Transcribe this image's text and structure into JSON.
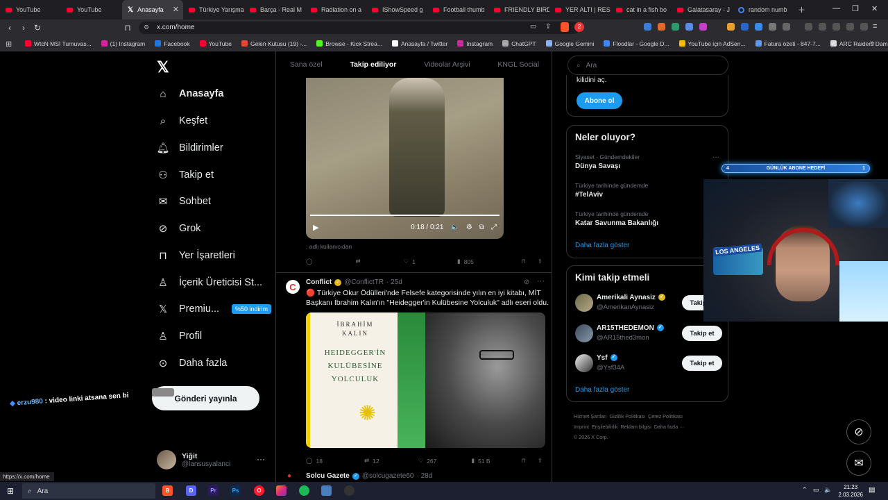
{
  "browser": {
    "tabs": [
      {
        "title": "YouTube",
        "icon": "youtube"
      },
      {
        "title": "YouTube",
        "icon": "youtube"
      },
      {
        "title": "Anasayfa",
        "icon": "x",
        "active": true
      },
      {
        "title": "Türkiye Yarışma",
        "icon": "youtube"
      },
      {
        "title": "Barça - Real M",
        "icon": "youtube"
      },
      {
        "title": "Radiation on a",
        "icon": "youtube"
      },
      {
        "title": "IShowSpeed g",
        "icon": "youtube"
      },
      {
        "title": "Football thumb",
        "icon": "youtube"
      },
      {
        "title": "FRIENDLY BIRD",
        "icon": "youtube"
      },
      {
        "title": "YER ALTI | RESI",
        "icon": "youtube"
      },
      {
        "title": "cat in a fish bo",
        "icon": "youtube"
      },
      {
        "title": "Galatasaray - J",
        "icon": "youtube"
      },
      {
        "title": "random numb",
        "icon": "google"
      }
    ],
    "url": "x.com/home",
    "status_url": "https://x.com/home",
    "notification_count": "2",
    "bookmarks": [
      {
        "label": "WtcN MSI Turnuvas...",
        "color": "#ff0033"
      },
      {
        "label": "(1) Instagram",
        "color": "#d6249f"
      },
      {
        "label": "Facebook",
        "color": "#1877f2"
      },
      {
        "label": "YouTube",
        "color": "#ff0033"
      },
      {
        "label": "Gelen Kutusu (19) -...",
        "color": "#ea4335"
      },
      {
        "label": "Browse - Kick Strea...",
        "color": "#53fc18"
      },
      {
        "label": "Anasayfa / Twitter",
        "color": "#ffffff"
      },
      {
        "label": "Instagram",
        "color": "#d6249f"
      },
      {
        "label": "ChatGPT",
        "color": "#aaaaaa"
      },
      {
        "label": "Google Gemini",
        "color": "#8ab4f8"
      },
      {
        "label": "Floodlar - Google D...",
        "color": "#4285f4"
      },
      {
        "label": "YouTube için AdSen...",
        "color": "#fbbc04"
      },
      {
        "label": "Fatura özeti - 847-7...",
        "color": "#5e97f6"
      },
      {
        "label": "ARC Raiders Dam B...",
        "color": "#dddddd"
      }
    ]
  },
  "nav": {
    "items": [
      {
        "label": "Anasayfa",
        "icon": "home-icon",
        "bold": true
      },
      {
        "label": "Keşfet",
        "icon": "search-icon"
      },
      {
        "label": "Bildirimler",
        "icon": "bell-icon"
      },
      {
        "label": "Takip et",
        "icon": "person-add-icon"
      },
      {
        "label": "Sohbet",
        "icon": "mail-icon"
      },
      {
        "label": "Grok",
        "icon": "grok-icon"
      },
      {
        "label": "Yer İşaretleri",
        "icon": "bookmark-icon"
      },
      {
        "label": "İçerik Üreticisi St...",
        "icon": "creator-icon"
      },
      {
        "label": "Premiu...",
        "icon": "x-icon",
        "badge": "%50 indirim"
      },
      {
        "label": "Profil",
        "icon": "profile-icon"
      },
      {
        "label": "Daha fazla",
        "icon": "more-icon"
      }
    ],
    "post_button": "Gönderi yayınla",
    "user": {
      "name": "Yiğit",
      "handle": "@lansusyalanci"
    }
  },
  "chat_overlay": {
    "user": "erzu980",
    "message": ": video linki atsana sen bi"
  },
  "feed": {
    "tabs": [
      "Sana özel",
      "Takip ediliyor",
      "Videolar Arşivi",
      "KNGL Social"
    ],
    "active_tab": "Takip ediliyor",
    "post1": {
      "video_time": "0:18 / 0:21",
      "alt_text": "adlı kullanıcıdan",
      "likes": "1",
      "views": "805"
    },
    "post2": {
      "name": "Conflict",
      "handle": "@ConflictTR",
      "age": "· 25d",
      "text": "🔴 Türkiye Okur Ödülleri'nde Felsefe kategorisinde yılın en iyi kitabı, MİT Başkanı İbrahim Kalın'ın \"Heidegger'in Kulübesine Yolculuk\" adlı eseri oldu.",
      "book_author_1": "İBRAHİM",
      "book_author_2": "KALIN",
      "book_title_1": "HEIDEGGER'İN",
      "book_title_2": "KULÜBESİNE",
      "book_title_3": "YOLCULUK",
      "replies": "18",
      "reposts": "12",
      "likes": "267",
      "views": "51 B"
    },
    "post3": {
      "name": "Solcu Gazete",
      "handle": "@solcugazete60",
      "age": "· 28d"
    }
  },
  "sidebar": {
    "search_placeholder": "Ara",
    "premium_text": "kilidini aç.",
    "subscribe_button": "Abone ol",
    "trends_title": "Neler oluyor?",
    "trends": [
      {
        "context": "Siyaset · Gündemdekiler",
        "name": "Dünya Savaşı"
      },
      {
        "context": "Türkiye tarihinde gündemde",
        "name": "#TelAviv"
      },
      {
        "context": "Türkiye tarihinde gündemde",
        "name": "Katar Savunma Bakanlığı"
      }
    ],
    "show_more": "Daha fazla göster",
    "follow_title": "Kimi takip etmeli",
    "suggestions": [
      {
        "name": "Amerikali Aynasiz",
        "handle": "@AmerikanAynasiz",
        "verified": "gold",
        "button": "Takip et"
      },
      {
        "name": "AR15THEDEMON",
        "handle": "@AR15thed3mon",
        "verified": "blue",
        "button": "Takip et"
      },
      {
        "name": "Ysf",
        "handle": "@Ysf34A",
        "verified": "blue",
        "button": "Takip et"
      }
    ],
    "footer": [
      "Hizmet Şartları",
      "Gizlilik Politikası",
      "Çerez Politikası",
      "Imprint",
      "Erişilebilirlik",
      "Reklam bilgisi",
      "Daha fazla ···",
      "© 2026 X Corp."
    ]
  },
  "stream": {
    "goal_left": "4",
    "goal_label": "GÜNLÜK ABONE HEDEFİ",
    "goal_right": "1",
    "sign_text": "LOS ANGELES"
  },
  "taskbar": {
    "search": "Ara",
    "time": "21:23",
    "date": "2.03.2026"
  }
}
